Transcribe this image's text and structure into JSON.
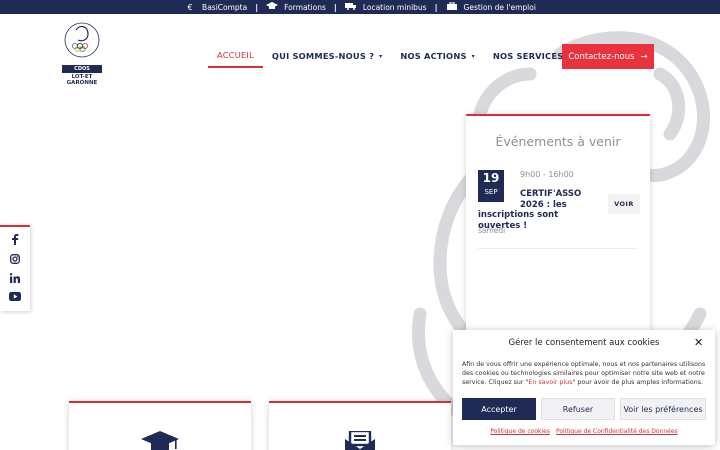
{
  "topbar": {
    "items": [
      {
        "label": "BasiCompta",
        "icon": "euro-icon"
      },
      {
        "label": "Formations",
        "icon": "graduation-cap-icon"
      },
      {
        "label": "Location minibus",
        "icon": "truck-icon"
      },
      {
        "label": "Gestion de l'emploi",
        "icon": "briefcase-icon"
      }
    ]
  },
  "logo": {
    "box_label": "CDOS",
    "sub_line1": "LOT-ET",
    "sub_line2": "GARONNE"
  },
  "nav": {
    "items": [
      {
        "label": "ACCUEIL",
        "active": true
      },
      {
        "label": "QUI SOMMES-NOUS ?",
        "caret": "▾"
      },
      {
        "label": "NOS ACTIONS",
        "caret": "▾"
      },
      {
        "label": "NOS SERVICES",
        "caret": "▾"
      }
    ],
    "contact_label": "Contactez-nous",
    "contact_arrow": "→"
  },
  "social": [
    "facebook-icon",
    "instagram-icon",
    "linkedin-icon",
    "youtube-icon"
  ],
  "events": {
    "title": "Événements à venir",
    "item": {
      "day": "19",
      "month": "SEP",
      "time": "9h00 - 16h00",
      "title_line1": "CERTIF'ASSO",
      "title_line2": "2026 : les",
      "title_line3": "inscriptions sont ouvertes !",
      "weekday": "samedi",
      "cta": "VOIR"
    }
  },
  "consent": {
    "title": "Gérer le consentement aux cookies",
    "body_pre": "Afin de vous offrir une expérience optimale, nous et nos partenaires utilisons des cookies ou technologies similaires pour optimiser notre site web et notre service. Cliquez sur \"",
    "body_link": "En savoir plus",
    "body_post": "\" pour avoir de plus amples informations.",
    "accept": "Accepter",
    "refuse": "Refuser",
    "prefs": "Voir les préférences",
    "link_cookies": "Politique de cookies",
    "link_privacy": "Politique de Confidentialité des Données"
  },
  "colors": {
    "navy": "#1f2a55",
    "red": "#e8333f",
    "accent_line": "#d6303a"
  }
}
